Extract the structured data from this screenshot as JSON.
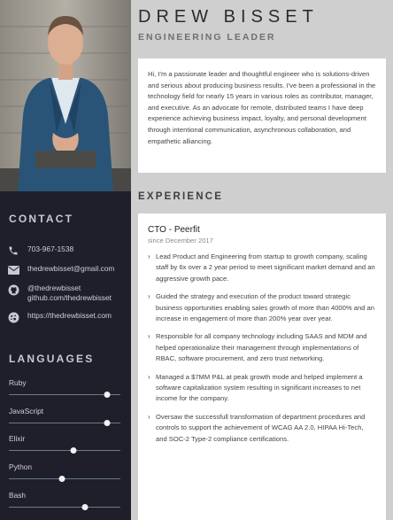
{
  "header": {
    "name": "DREW BISSET",
    "role": "ENGINEERING LEADER"
  },
  "about": "Hi, I'm a passionate leader and thoughtful engineer who is solutions-driven and serious about producing business results. I've been a professional in the technology field for nearly 15 years in various roles as contributor, manager, and executive. As an advocate for remote, distributed teams I have deep experience achieving business impact, loyalty, and personal development through intentional communication, asynchronous collaboration, and empathetic alliancing.",
  "sidebar": {
    "contact_title": "CONTACT",
    "contact": {
      "phone": "703-967-1538",
      "email": "thedrewbisset@gmail.com",
      "github_handle": "@thedrewbisset",
      "github_url": "github.com/thedrewbisset",
      "website": "https://thedrewbisset.com"
    },
    "languages_title": "LANGUAGES",
    "languages": [
      {
        "name": "Ruby",
        "level": 0.88
      },
      {
        "name": "JavaScript",
        "level": 0.88
      },
      {
        "name": "Elixir",
        "level": 0.58
      },
      {
        "name": "Python",
        "level": 0.48
      },
      {
        "name": "Bash",
        "level": 0.68
      }
    ]
  },
  "experience": {
    "title": "EXPERIENCE",
    "job_title": "CTO - Peerfit",
    "job_date": "since December 2017",
    "bullets": [
      "Lead Product and Engineering from startup to growth company, scaling staff by 6x over a 2 year period to meet significant market demand and an aggressive growth pace.",
      "Guided the strategy and execution of the product toward strategic business opportunities enabling sales growth of more than 4000% and an increase in engagement of more than 200% year over year.",
      "Responsible for all company technology including SAAS and MDM and helped operationalize their management through implementations of RBAC, software procurement, and zero trust networking.",
      "Managed a $7MM P&L at peak growth mode and helped implement a software capitalization system resulting in significant increases to net income for the company.",
      "Oversaw the successfull transformation of department procedures and controls to support the achievement of WCAG AA 2.0, HIPAA Hi-Tech, and SOC-2 Type-2 compliance certifications."
    ]
  },
  "colors": {
    "sidebar_bg": "#1e1f2b",
    "page_bg": "#cfcfcf",
    "track": "#6b7a8a"
  }
}
